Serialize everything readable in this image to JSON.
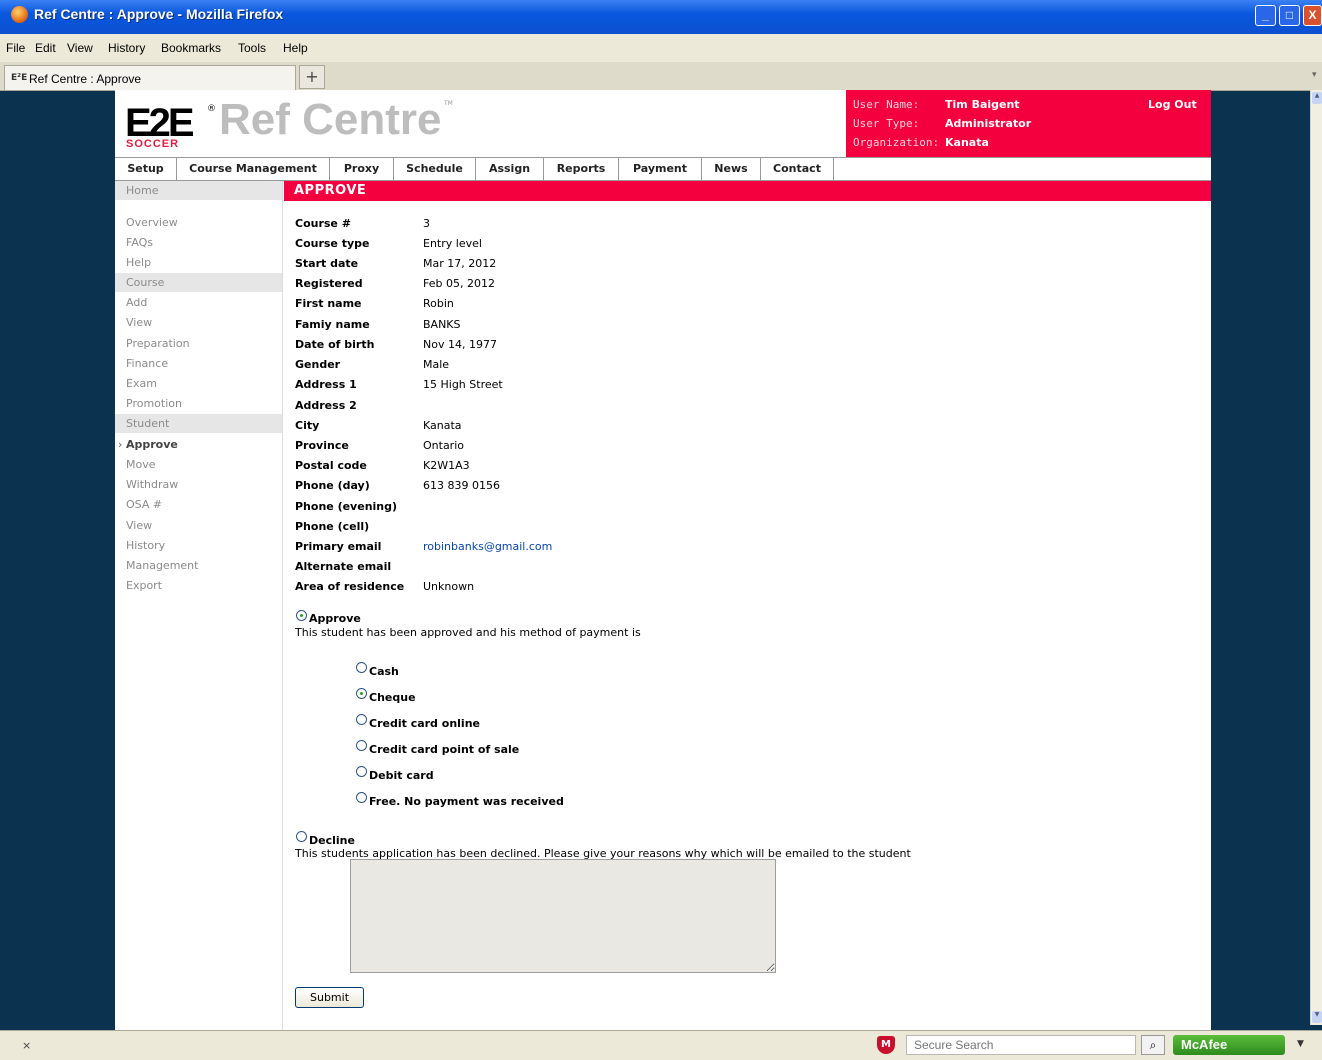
{
  "window": {
    "title": "Ref Centre : Approve - Mozilla Firefox",
    "controls": {
      "minimize": "_",
      "maximize": "□",
      "close": "X"
    }
  },
  "menu": [
    "File",
    "Edit",
    "View",
    "History",
    "Bookmarks",
    "Tools",
    "Help"
  ],
  "tab": {
    "favicon_text": "E²E",
    "label": "Ref Centre : Approve",
    "new_tab": "+"
  },
  "header": {
    "logo_mark": "E2E",
    "logo_sub": "SOCCER",
    "logo_reg": "®",
    "logo_title": "Ref Centre",
    "logo_tm": "TM",
    "user_name_label": "User Name:",
    "user_name": "Tim Baigent",
    "user_type_label": "User Type:",
    "user_type": "Administrator",
    "org_label": "Organization:",
    "org": "Kanata",
    "logout": "Log Out"
  },
  "nav": [
    "Setup",
    "Course Management",
    "Proxy",
    "Schedule",
    "Assign",
    "Reports",
    "Payment",
    "News",
    "Contact"
  ],
  "sidebar": {
    "items": [
      {
        "label": "Home",
        "type": "section"
      },
      {
        "label": "Overview",
        "type": "link"
      },
      {
        "label": "FAQs",
        "type": "link"
      },
      {
        "label": "Help",
        "type": "link"
      },
      {
        "label": "Course",
        "type": "section"
      },
      {
        "label": "Add",
        "type": "link"
      },
      {
        "label": "View",
        "type": "link"
      },
      {
        "label": "Preparation",
        "type": "link"
      },
      {
        "label": "Finance",
        "type": "link"
      },
      {
        "label": "Exam",
        "type": "link"
      },
      {
        "label": "Promotion",
        "type": "link"
      },
      {
        "label": "Student",
        "type": "section"
      },
      {
        "label": "Approve",
        "type": "active"
      },
      {
        "label": "Move",
        "type": "link"
      },
      {
        "label": "Withdraw",
        "type": "link"
      },
      {
        "label": "OSA #",
        "type": "link"
      },
      {
        "label": "View",
        "type": "link"
      },
      {
        "label": "History",
        "type": "link"
      },
      {
        "label": "Management",
        "type": "link"
      },
      {
        "label": "Export",
        "type": "link"
      }
    ],
    "active_caret": "›"
  },
  "page_heading": "APPROVE",
  "details": [
    {
      "label": "Course #",
      "value": "3"
    },
    {
      "label": "Course type",
      "value": "Entry level"
    },
    {
      "label": "Start date",
      "value": "Mar 17, 2012"
    },
    {
      "label": "Registered",
      "value": "Feb 05, 2012"
    },
    {
      "label": "First name",
      "value": "Robin"
    },
    {
      "label": "Famiy name",
      "value": "BANKS"
    },
    {
      "label": "Date of birth",
      "value": "Nov 14, 1977"
    },
    {
      "label": "Gender",
      "value": "Male"
    },
    {
      "label": "Address 1",
      "value": "15 High Street"
    },
    {
      "label": "Address 2",
      "value": ""
    },
    {
      "label": "City",
      "value": "Kanata"
    },
    {
      "label": "Province",
      "value": "Ontario"
    },
    {
      "label": "Postal code",
      "value": "K2W1A3"
    },
    {
      "label": "Phone (day)",
      "value": "613 839 0156"
    },
    {
      "label": "Phone (evening)",
      "value": ""
    },
    {
      "label": "Phone (cell)",
      "value": ""
    },
    {
      "label": "Primary email",
      "value": "robinbanks@gmail.com"
    },
    {
      "label": "Alternate email",
      "value": ""
    },
    {
      "label": "Area of residence",
      "value": "Unknown"
    }
  ],
  "approve": {
    "label": "Approve",
    "selected": true,
    "description": "This student has been approved and his method of payment is"
  },
  "payment_methods": [
    {
      "label": "Cash",
      "selected": false
    },
    {
      "label": "Cheque",
      "selected": true
    },
    {
      "label": "Credit card online",
      "selected": false
    },
    {
      "label": "Credit card point of sale",
      "selected": false
    },
    {
      "label": "Debit card",
      "selected": false
    },
    {
      "label": "Free. No payment was received",
      "selected": false
    }
  ],
  "decline": {
    "label": "Decline",
    "selected": false,
    "description": "This students application has been declined. Please give your reasons why which will be emailed to the student",
    "reason_value": ""
  },
  "submit_label": "Submit",
  "statusbar": {
    "close": "×",
    "search_placeholder": "Secure Search",
    "mcafee_label": "McAfee",
    "mcafee_shield": "M",
    "search_icon": "⌕",
    "dropdown": "▼"
  }
}
